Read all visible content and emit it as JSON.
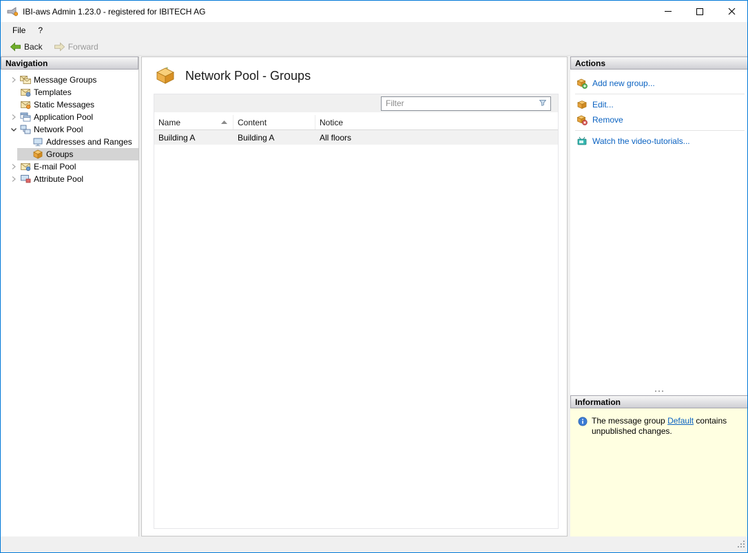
{
  "colors": {
    "window_border": "#0078D7",
    "link": "#0A62C1",
    "info_panel_bg": "#FFFFE1",
    "selection_bg": "#D4D4D4"
  },
  "window": {
    "title": "IBI-aws Admin 1.23.0 - registered for IBITECH AG",
    "controls": [
      "minimize",
      "maximize",
      "close"
    ]
  },
  "menu": {
    "items": [
      {
        "label": "File"
      },
      {
        "label": "?"
      }
    ]
  },
  "toolbar": {
    "back_label": "Back",
    "forward_label": "Forward"
  },
  "navigation": {
    "header": "Navigation",
    "items": [
      {
        "label": "Message Groups",
        "level": 0,
        "expander": "collapsed",
        "icon": "message-groups-icon",
        "selected": false
      },
      {
        "label": "Templates",
        "level": 0,
        "expander": "none",
        "icon": "templates-icon",
        "selected": false
      },
      {
        "label": "Static Messages",
        "level": 0,
        "expander": "none",
        "icon": "static-messages-icon",
        "selected": false
      },
      {
        "label": "Application Pool",
        "level": 0,
        "expander": "collapsed",
        "icon": "application-pool-icon",
        "selected": false
      },
      {
        "label": "Network Pool",
        "level": 0,
        "expander": "expanded",
        "icon": "network-pool-icon",
        "selected": false
      },
      {
        "label": "Addresses and Ranges",
        "level": 1,
        "expander": "none",
        "icon": "addresses-and-ranges-icon",
        "selected": false
      },
      {
        "label": "Groups",
        "level": 1,
        "expander": "none",
        "icon": "groups-icon",
        "selected": true
      },
      {
        "label": "E-mail Pool",
        "level": 0,
        "expander": "collapsed",
        "icon": "email-pool-icon",
        "selected": false
      },
      {
        "label": "Attribute Pool",
        "level": 0,
        "expander": "collapsed",
        "icon": "attribute-pool-icon",
        "selected": false
      }
    ]
  },
  "main": {
    "title": "Network Pool - Groups",
    "filter_placeholder": "Filter",
    "table": {
      "columns": [
        "Name",
        "Content",
        "Notice"
      ],
      "sort": {
        "column": "Name",
        "direction": "ascending"
      },
      "rows": [
        [
          "Building A",
          "Building A",
          "All floors"
        ]
      ]
    }
  },
  "actions": {
    "header": "Actions",
    "items": [
      {
        "label": "Add new group...",
        "icon": "add-group-icon"
      },
      {
        "label": "Edit...",
        "icon": "edit-group-icon"
      },
      {
        "label": "Remove",
        "icon": "remove-group-icon"
      },
      {
        "label": "Watch the video-tutorials...",
        "icon": "video-tutorials-icon"
      }
    ]
  },
  "information": {
    "header": "Information",
    "message": {
      "text_before": "The message group ",
      "link_label": "Default",
      "text_after": " contains unpublished changes."
    }
  }
}
